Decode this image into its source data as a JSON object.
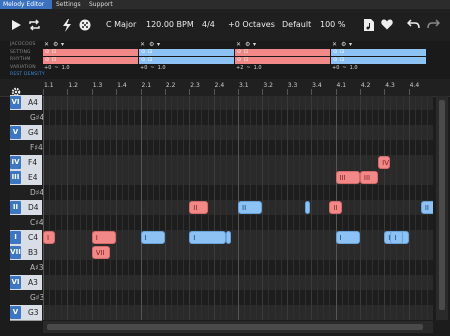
{
  "tabs": [
    {
      "label": "Melody Editor",
      "active": true
    },
    {
      "label": "Settings",
      "active": false
    },
    {
      "label": "Support",
      "active": false
    }
  ],
  "toolbar": {
    "play_icon": "play-icon",
    "loop_icon": "loop-icon",
    "generate_icon": "lightning-icon",
    "dice_icon": "dice-icon",
    "key": "C Major",
    "tempo": "120.00 BPM",
    "time_signature": "4/4",
    "octaves": "+0 Octaves",
    "preset": "Default",
    "zoom": "100 %",
    "file_icon": "file-music-icon",
    "favorite_icon": "heart-icon",
    "undo_icon": "undo-icon",
    "redo_icon": "redo-icon"
  },
  "track_labels": [
    "JACOCOOS",
    "SETTING",
    "RHYTHM",
    "VARIATION",
    "REST DENSITY"
  ],
  "track_segments": [
    {
      "color": "red",
      "variation": "+0"
    },
    {
      "color": "blue",
      "variation": "+0"
    },
    {
      "color": "red",
      "variation": "+2"
    },
    {
      "color": "blue",
      "variation": "+0"
    }
  ],
  "track_controls": {
    "random_value": "1.0",
    "symbol": "~"
  },
  "ruler": [
    "1.1",
    "1.2",
    "1.3",
    "1.4",
    "2.1",
    "2.2",
    "2.3",
    "2.4",
    "3.1",
    "3.2",
    "3.3",
    "3.4",
    "4.1",
    "4.2",
    "4.3",
    "4.4"
  ],
  "keys": [
    {
      "degree": "VI",
      "pitch": "A4",
      "black": false
    },
    {
      "degree": "",
      "pitch": "G♯4",
      "black": true
    },
    {
      "degree": "V",
      "pitch": "G4",
      "black": false
    },
    {
      "degree": "",
      "pitch": "F♯4",
      "black": true
    },
    {
      "degree": "IV",
      "pitch": "F4",
      "black": false
    },
    {
      "degree": "III",
      "pitch": "E4",
      "black": false
    },
    {
      "degree": "",
      "pitch": "D♯4",
      "black": true
    },
    {
      "degree": "II",
      "pitch": "D4",
      "black": false
    },
    {
      "degree": "",
      "pitch": "C♯4",
      "black": true
    },
    {
      "degree": "I",
      "pitch": "C4",
      "black": false
    },
    {
      "degree": "VII",
      "pitch": "B3",
      "black": false
    },
    {
      "degree": "",
      "pitch": "A♯3",
      "black": true
    },
    {
      "degree": "VI",
      "pitch": "A3",
      "black": false
    },
    {
      "degree": "",
      "pitch": "G♯3",
      "black": true
    },
    {
      "degree": "V",
      "pitch": "G3",
      "black": false
    }
  ],
  "notes": [
    {
      "label": "IV",
      "row": 4,
      "start": 3.4375,
      "dur": 0.125,
      "color": "red"
    },
    {
      "label": "III",
      "row": 5,
      "start": 3.0,
      "dur": 0.25,
      "color": "red"
    },
    {
      "label": "III",
      "row": 5,
      "start": 3.25,
      "dur": 0.1875,
      "color": "red"
    },
    {
      "label": "II",
      "row": 7,
      "start": 1.5,
      "dur": 0.1875,
      "color": "red"
    },
    {
      "label": "II",
      "row": 7,
      "start": 2.0,
      "dur": 0.25,
      "color": "blue"
    },
    {
      "label": "",
      "row": 7,
      "start": 2.6875,
      "dur": 0.03,
      "color": "blue"
    },
    {
      "label": "II",
      "row": 7,
      "start": 2.9375,
      "dur": 0.125,
      "color": "red"
    },
    {
      "label": "II",
      "row": 7,
      "start": 3.875,
      "dur": 0.1875,
      "color": "blue"
    },
    {
      "label": "I",
      "row": 9,
      "start": 0.0,
      "dur": 0.125,
      "color": "red"
    },
    {
      "label": "I",
      "row": 9,
      "start": 0.5,
      "dur": 0.25,
      "color": "red"
    },
    {
      "label": "I",
      "row": 9,
      "start": 1.0,
      "dur": 0.25,
      "color": "blue"
    },
    {
      "label": "I",
      "row": 9,
      "start": 1.5,
      "dur": 0.375,
      "color": "blue"
    },
    {
      "label": "",
      "row": 9,
      "start": 1.875,
      "dur": 0.05,
      "color": "blue"
    },
    {
      "label": "I",
      "row": 9,
      "start": 3.0,
      "dur": 0.25,
      "color": "blue"
    },
    {
      "label": "I",
      "row": 9,
      "start": 3.5,
      "dur": 0.25,
      "color": "blue"
    },
    {
      "label": "I",
      "row": 9,
      "start": 3.5625,
      "dur": 0.125,
      "color": "blue"
    },
    {
      "label": "VII",
      "row": 10,
      "start": 0.5,
      "dur": 0.1875,
      "color": "red"
    }
  ]
}
